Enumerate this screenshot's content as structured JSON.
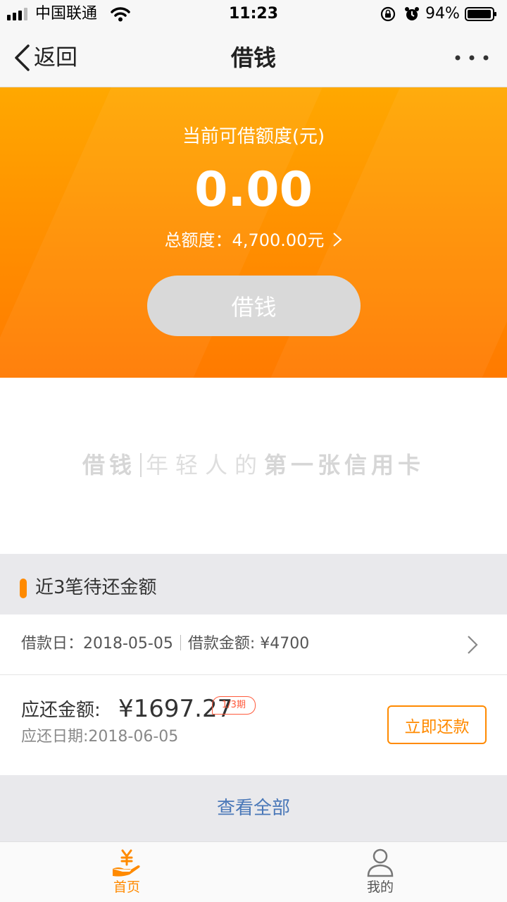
{
  "status_bar": {
    "carrier": "中国联通",
    "time": "11:23",
    "battery": "94%"
  },
  "nav": {
    "back_label": "返回",
    "title": "借钱"
  },
  "hero": {
    "label": "当前可借额度(元)",
    "amount": "0.00",
    "total": "总额度：4,700.00元",
    "button_label": "借钱"
  },
  "slogan": {
    "brand": "借钱",
    "text_light": "年轻人的",
    "text_bold": "第一张信用卡"
  },
  "repayment": {
    "section_title": "近3笔待还金额",
    "loan_date": "借款日：2018-05-05",
    "loan_amount": "借款金额: ¥4700",
    "due_label": "应还金额: ",
    "due_amount": "¥1697.27",
    "period": "1/3期",
    "due_date": "应还日期:2018-06-05",
    "repay_button": "立即还款",
    "view_all": "查看全部"
  },
  "tabs": [
    {
      "label": "首页",
      "icon": "yen-hand-icon",
      "active": true
    },
    {
      "label": "我的",
      "icon": "user-icon",
      "active": false
    }
  ],
  "colors": {
    "accent": "#ff8a00",
    "hero_top": "#ffa800",
    "hero_bottom": "#ff7a00",
    "link": "#4a78b8",
    "period_badge": "#ff5a3c"
  }
}
